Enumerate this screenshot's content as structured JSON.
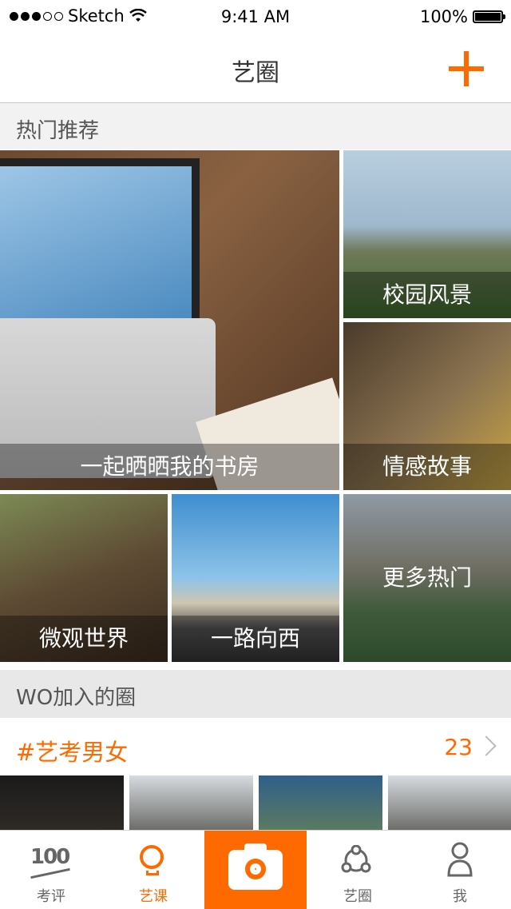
{
  "status_bar": {
    "carrier": "Sketch",
    "time": "9:41 AM",
    "battery": "100%",
    "signal_dots_filled": 3,
    "signal_dots_total": 5
  },
  "nav": {
    "title": "艺圈",
    "add_icon": "plus-icon"
  },
  "sections": {
    "hot": "热门推荐",
    "joined": "WO加入的圈"
  },
  "tiles": [
    {
      "label": "一起晒晒我的书房"
    },
    {
      "label": "校园风景"
    },
    {
      "label": "情感故事"
    },
    {
      "label": "微观世界"
    },
    {
      "label": "一路向西"
    },
    {
      "label": "更多热门"
    }
  ],
  "group": {
    "name": "#艺考男女",
    "count": "23"
  },
  "tabs": [
    {
      "label": "考评",
      "icon_text": "100",
      "icon": "score-100-icon"
    },
    {
      "label": "艺课",
      "icon": "lightbulb-icon"
    },
    {
      "label": "",
      "icon": "camera-icon"
    },
    {
      "label": "艺圈",
      "icon": "circle-share-icon"
    },
    {
      "label": "我",
      "icon": "person-icon"
    }
  ],
  "colors": {
    "accent": "#ff6a00",
    "section_bg": "#f2f2f2",
    "text": "#333333"
  }
}
